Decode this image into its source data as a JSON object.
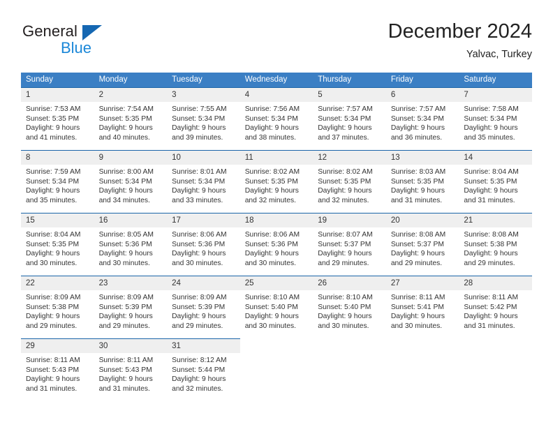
{
  "brand": {
    "name_part1": "General",
    "name_part2": "Blue",
    "triangle_color": "#1567b2",
    "blue_color": "#1a87d8"
  },
  "header": {
    "title": "December 2024",
    "location": "Yalvac, Turkey"
  },
  "theme": {
    "header_row_bg": "#3b7fc4",
    "daynum_bg": "#efefef",
    "daynum_border": "#1a64a8",
    "text": "#333333"
  },
  "weekdays": [
    "Sunday",
    "Monday",
    "Tuesday",
    "Wednesday",
    "Thursday",
    "Friday",
    "Saturday"
  ],
  "weeks": [
    [
      {
        "day": "1",
        "sunrise": "Sunrise: 7:53 AM",
        "sunset": "Sunset: 5:35 PM",
        "daylight_1": "Daylight: 9 hours",
        "daylight_2": "and 41 minutes."
      },
      {
        "day": "2",
        "sunrise": "Sunrise: 7:54 AM",
        "sunset": "Sunset: 5:35 PM",
        "daylight_1": "Daylight: 9 hours",
        "daylight_2": "and 40 minutes."
      },
      {
        "day": "3",
        "sunrise": "Sunrise: 7:55 AM",
        "sunset": "Sunset: 5:34 PM",
        "daylight_1": "Daylight: 9 hours",
        "daylight_2": "and 39 minutes."
      },
      {
        "day": "4",
        "sunrise": "Sunrise: 7:56 AM",
        "sunset": "Sunset: 5:34 PM",
        "daylight_1": "Daylight: 9 hours",
        "daylight_2": "and 38 minutes."
      },
      {
        "day": "5",
        "sunrise": "Sunrise: 7:57 AM",
        "sunset": "Sunset: 5:34 PM",
        "daylight_1": "Daylight: 9 hours",
        "daylight_2": "and 37 minutes."
      },
      {
        "day": "6",
        "sunrise": "Sunrise: 7:57 AM",
        "sunset": "Sunset: 5:34 PM",
        "daylight_1": "Daylight: 9 hours",
        "daylight_2": "and 36 minutes."
      },
      {
        "day": "7",
        "sunrise": "Sunrise: 7:58 AM",
        "sunset": "Sunset: 5:34 PM",
        "daylight_1": "Daylight: 9 hours",
        "daylight_2": "and 35 minutes."
      }
    ],
    [
      {
        "day": "8",
        "sunrise": "Sunrise: 7:59 AM",
        "sunset": "Sunset: 5:34 PM",
        "daylight_1": "Daylight: 9 hours",
        "daylight_2": "and 35 minutes."
      },
      {
        "day": "9",
        "sunrise": "Sunrise: 8:00 AM",
        "sunset": "Sunset: 5:34 PM",
        "daylight_1": "Daylight: 9 hours",
        "daylight_2": "and 34 minutes."
      },
      {
        "day": "10",
        "sunrise": "Sunrise: 8:01 AM",
        "sunset": "Sunset: 5:34 PM",
        "daylight_1": "Daylight: 9 hours",
        "daylight_2": "and 33 minutes."
      },
      {
        "day": "11",
        "sunrise": "Sunrise: 8:02 AM",
        "sunset": "Sunset: 5:35 PM",
        "daylight_1": "Daylight: 9 hours",
        "daylight_2": "and 32 minutes."
      },
      {
        "day": "12",
        "sunrise": "Sunrise: 8:02 AM",
        "sunset": "Sunset: 5:35 PM",
        "daylight_1": "Daylight: 9 hours",
        "daylight_2": "and 32 minutes."
      },
      {
        "day": "13",
        "sunrise": "Sunrise: 8:03 AM",
        "sunset": "Sunset: 5:35 PM",
        "daylight_1": "Daylight: 9 hours",
        "daylight_2": "and 31 minutes."
      },
      {
        "day": "14",
        "sunrise": "Sunrise: 8:04 AM",
        "sunset": "Sunset: 5:35 PM",
        "daylight_1": "Daylight: 9 hours",
        "daylight_2": "and 31 minutes."
      }
    ],
    [
      {
        "day": "15",
        "sunrise": "Sunrise: 8:04 AM",
        "sunset": "Sunset: 5:35 PM",
        "daylight_1": "Daylight: 9 hours",
        "daylight_2": "and 30 minutes."
      },
      {
        "day": "16",
        "sunrise": "Sunrise: 8:05 AM",
        "sunset": "Sunset: 5:36 PM",
        "daylight_1": "Daylight: 9 hours",
        "daylight_2": "and 30 minutes."
      },
      {
        "day": "17",
        "sunrise": "Sunrise: 8:06 AM",
        "sunset": "Sunset: 5:36 PM",
        "daylight_1": "Daylight: 9 hours",
        "daylight_2": "and 30 minutes."
      },
      {
        "day": "18",
        "sunrise": "Sunrise: 8:06 AM",
        "sunset": "Sunset: 5:36 PM",
        "daylight_1": "Daylight: 9 hours",
        "daylight_2": "and 30 minutes."
      },
      {
        "day": "19",
        "sunrise": "Sunrise: 8:07 AM",
        "sunset": "Sunset: 5:37 PM",
        "daylight_1": "Daylight: 9 hours",
        "daylight_2": "and 29 minutes."
      },
      {
        "day": "20",
        "sunrise": "Sunrise: 8:08 AM",
        "sunset": "Sunset: 5:37 PM",
        "daylight_1": "Daylight: 9 hours",
        "daylight_2": "and 29 minutes."
      },
      {
        "day": "21",
        "sunrise": "Sunrise: 8:08 AM",
        "sunset": "Sunset: 5:38 PM",
        "daylight_1": "Daylight: 9 hours",
        "daylight_2": "and 29 minutes."
      }
    ],
    [
      {
        "day": "22",
        "sunrise": "Sunrise: 8:09 AM",
        "sunset": "Sunset: 5:38 PM",
        "daylight_1": "Daylight: 9 hours",
        "daylight_2": "and 29 minutes."
      },
      {
        "day": "23",
        "sunrise": "Sunrise: 8:09 AM",
        "sunset": "Sunset: 5:39 PM",
        "daylight_1": "Daylight: 9 hours",
        "daylight_2": "and 29 minutes."
      },
      {
        "day": "24",
        "sunrise": "Sunrise: 8:09 AM",
        "sunset": "Sunset: 5:39 PM",
        "daylight_1": "Daylight: 9 hours",
        "daylight_2": "and 29 minutes."
      },
      {
        "day": "25",
        "sunrise": "Sunrise: 8:10 AM",
        "sunset": "Sunset: 5:40 PM",
        "daylight_1": "Daylight: 9 hours",
        "daylight_2": "and 30 minutes."
      },
      {
        "day": "26",
        "sunrise": "Sunrise: 8:10 AM",
        "sunset": "Sunset: 5:40 PM",
        "daylight_1": "Daylight: 9 hours",
        "daylight_2": "and 30 minutes."
      },
      {
        "day": "27",
        "sunrise": "Sunrise: 8:11 AM",
        "sunset": "Sunset: 5:41 PM",
        "daylight_1": "Daylight: 9 hours",
        "daylight_2": "and 30 minutes."
      },
      {
        "day": "28",
        "sunrise": "Sunrise: 8:11 AM",
        "sunset": "Sunset: 5:42 PM",
        "daylight_1": "Daylight: 9 hours",
        "daylight_2": "and 31 minutes."
      }
    ],
    [
      {
        "day": "29",
        "sunrise": "Sunrise: 8:11 AM",
        "sunset": "Sunset: 5:43 PM",
        "daylight_1": "Daylight: 9 hours",
        "daylight_2": "and 31 minutes."
      },
      {
        "day": "30",
        "sunrise": "Sunrise: 8:11 AM",
        "sunset": "Sunset: 5:43 PM",
        "daylight_1": "Daylight: 9 hours",
        "daylight_2": "and 31 minutes."
      },
      {
        "day": "31",
        "sunrise": "Sunrise: 8:12 AM",
        "sunset": "Sunset: 5:44 PM",
        "daylight_1": "Daylight: 9 hours",
        "daylight_2": "and 32 minutes."
      },
      {
        "day": "",
        "sunrise": "",
        "sunset": "",
        "daylight_1": "",
        "daylight_2": ""
      },
      {
        "day": "",
        "sunrise": "",
        "sunset": "",
        "daylight_1": "",
        "daylight_2": ""
      },
      {
        "day": "",
        "sunrise": "",
        "sunset": "",
        "daylight_1": "",
        "daylight_2": ""
      },
      {
        "day": "",
        "sunrise": "",
        "sunset": "",
        "daylight_1": "",
        "daylight_2": ""
      }
    ]
  ]
}
